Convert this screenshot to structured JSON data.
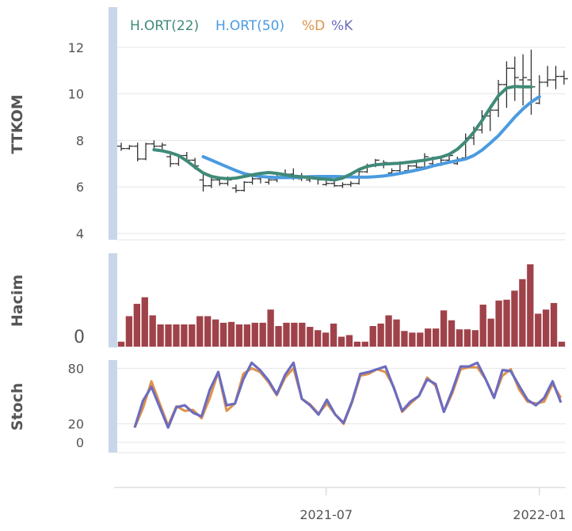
{
  "chart_data": {
    "type": "stock-panels",
    "colors": {
      "ohlc": "#333333",
      "ma22": "#3f8a78",
      "ma50": "#4a9be0",
      "stoch_d": "#e0924a",
      "stoch_k": "#6c6cbf",
      "volume": "#a0424a",
      "panel_bar": "#c9d6ea",
      "grid": "#e5e5e5"
    },
    "legend": [
      {
        "label": "H.ORT(22)",
        "color": "#3f8a78"
      },
      {
        "label": "H.ORT(50)",
        "color": "#4a9be0"
      },
      {
        "label": "%D",
        "color": "#e0924a"
      },
      {
        "label": "%K",
        "color": "#6c6cbf"
      }
    ],
    "x_ticks": [
      {
        "label": "2021-07",
        "week": 25
      },
      {
        "label": "2022-01",
        "week": 51
      }
    ],
    "price_panel": {
      "ylabel": "TTKOM",
      "ylim": [
        3.8,
        13.6
      ],
      "y_ticks": [
        "4",
        "6",
        "8",
        "10",
        "12"
      ],
      "y_tick_values": [
        4,
        6,
        8,
        10,
        12
      ],
      "weeks": 54,
      "ohlc": [
        [
          7.75,
          7.9,
          7.55,
          7.65
        ],
        [
          7.65,
          7.8,
          7.6,
          7.75
        ],
        [
          7.75,
          7.9,
          7.1,
          7.2
        ],
        [
          7.2,
          7.9,
          7.15,
          7.85
        ],
        [
          7.85,
          8.0,
          7.6,
          7.75
        ],
        [
          7.75,
          7.9,
          7.6,
          7.8
        ],
        [
          7.3,
          7.45,
          6.85,
          7.0
        ],
        [
          7.0,
          7.4,
          6.9,
          7.35
        ],
        [
          7.35,
          7.5,
          7.05,
          7.15
        ],
        [
          7.15,
          7.25,
          6.75,
          6.9
        ],
        [
          6.3,
          6.55,
          5.8,
          6.05
        ],
        [
          6.05,
          6.4,
          5.95,
          6.3
        ],
        [
          6.3,
          6.45,
          6.05,
          6.15
        ],
        [
          6.15,
          6.45,
          6.05,
          6.3
        ],
        [
          5.95,
          6.1,
          5.75,
          5.85
        ],
        [
          5.85,
          6.25,
          5.8,
          6.2
        ],
        [
          6.2,
          6.5,
          6.1,
          6.35
        ],
        [
          6.35,
          6.5,
          6.15,
          6.45
        ],
        [
          6.2,
          6.4,
          6.1,
          6.3
        ],
        [
          6.3,
          6.55,
          6.2,
          6.45
        ],
        [
          6.45,
          6.75,
          6.35,
          6.55
        ],
        [
          6.55,
          6.8,
          6.3,
          6.5
        ],
        [
          6.35,
          6.6,
          6.25,
          6.4
        ],
        [
          6.3,
          6.5,
          6.2,
          6.45
        ],
        [
          6.35,
          6.45,
          6.1,
          6.3
        ],
        [
          6.1,
          6.3,
          6.05,
          6.15
        ],
        [
          6.15,
          6.35,
          6.0,
          6.05
        ],
        [
          6.05,
          6.2,
          5.95,
          6.1
        ],
        [
          6.1,
          6.25,
          6.0,
          6.15
        ],
        [
          6.15,
          6.7,
          6.1,
          6.65
        ],
        [
          6.65,
          7.0,
          6.6,
          6.9
        ],
        [
          6.9,
          7.2,
          6.85,
          7.15
        ],
        [
          7.0,
          7.15,
          6.8,
          7.05
        ],
        [
          6.6,
          6.8,
          6.45,
          6.7
        ],
        [
          6.7,
          7.1,
          6.6,
          7.05
        ],
        [
          6.7,
          6.95,
          6.6,
          6.9
        ],
        [
          6.9,
          7.1,
          6.8,
          6.85
        ],
        [
          6.85,
          7.45,
          6.8,
          7.3
        ],
        [
          7.0,
          7.3,
          6.9,
          7.2
        ],
        [
          7.0,
          7.25,
          6.9,
          7.15
        ],
        [
          7.15,
          7.4,
          7.0,
          7.35
        ],
        [
          7.0,
          7.3,
          6.95,
          7.2
        ],
        [
          7.25,
          8.3,
          7.2,
          8.1
        ],
        [
          8.1,
          8.6,
          7.8,
          8.45
        ],
        [
          8.45,
          9.3,
          8.3,
          9.05
        ],
        [
          9.05,
          9.5,
          8.4,
          9.3
        ],
        [
          9.3,
          10.6,
          9.0,
          10.4
        ],
        [
          10.4,
          11.4,
          9.4,
          11.1
        ],
        [
          11.1,
          11.6,
          9.7,
          10.7
        ],
        [
          10.6,
          11.7,
          9.5,
          10.7
        ],
        [
          10.6,
          11.9,
          9.1,
          10.3
        ],
        [
          9.6,
          10.8,
          9.55,
          10.5
        ],
        [
          10.5,
          11.2,
          10.3,
          10.6
        ],
        [
          10.6,
          11.2,
          10.2,
          10.75
        ],
        [
          10.75,
          11.0,
          10.4,
          10.65
        ]
      ],
      "ma22": [
        7.6,
        7.55,
        7.47,
        7.35,
        7.12,
        6.85,
        6.6,
        6.45,
        6.38,
        6.35,
        6.38,
        6.45,
        6.52,
        6.58,
        6.62,
        6.58,
        6.52,
        6.46,
        6.44,
        6.4,
        6.36,
        6.33,
        6.3,
        6.38,
        6.55,
        6.75,
        6.88,
        6.95,
        6.98,
        7.0,
        7.02,
        7.06,
        7.1,
        7.15,
        7.22,
        7.28,
        7.4,
        7.62,
        7.95,
        8.35,
        8.85,
        9.4,
        9.92,
        10.25,
        10.32,
        10.3,
        10.3
      ],
      "ma50": [
        7.3,
        7.15,
        7.0,
        6.85,
        6.7,
        6.57,
        6.5,
        6.45,
        6.42,
        6.4,
        6.4,
        6.4,
        6.42,
        6.44,
        6.45,
        6.45,
        6.45,
        6.44,
        6.43,
        6.42,
        6.42,
        6.44,
        6.47,
        6.52,
        6.58,
        6.65,
        6.72,
        6.8,
        6.9,
        6.98,
        7.06,
        7.13,
        7.2,
        7.35,
        7.58,
        7.88,
        8.2,
        8.6,
        9.0,
        9.35,
        9.65,
        9.88
      ]
    },
    "volume_panel": {
      "ylabel": "Hacim",
      "y_ticks": [
        "0"
      ],
      "values": [
        0.06,
        0.37,
        0.52,
        0.6,
        0.38,
        0.27,
        0.27,
        0.27,
        0.27,
        0.27,
        0.37,
        0.37,
        0.33,
        0.29,
        0.3,
        0.27,
        0.27,
        0.29,
        0.29,
        0.45,
        0.25,
        0.29,
        0.29,
        0.29,
        0.24,
        0.2,
        0.17,
        0.28,
        0.12,
        0.14,
        0.06,
        0.06,
        0.25,
        0.28,
        0.38,
        0.33,
        0.19,
        0.17,
        0.17,
        0.22,
        0.22,
        0.44,
        0.32,
        0.21,
        0.21,
        0.2,
        0.51,
        0.34,
        0.56,
        0.57,
        0.68,
        0.82,
        1.0,
        0.4,
        0.45,
        0.53,
        0.06
      ]
    },
    "stoch_panel": {
      "ylabel": "Stoch",
      "ylim": [
        0,
        100
      ],
      "y_ticks": [
        "0",
        "20",
        "80"
      ],
      "y_tick_values": [
        0,
        20,
        80
      ],
      "k": [
        16,
        45,
        60,
        38,
        16,
        38,
        40,
        32,
        28,
        57,
        76,
        40,
        42,
        68,
        86,
        78,
        67,
        52,
        73,
        86,
        47,
        40,
        30,
        46,
        30,
        21,
        44,
        74,
        76,
        79,
        82,
        59,
        34,
        44,
        50,
        68,
        63,
        33,
        56,
        82,
        82,
        86,
        68,
        48,
        78,
        77,
        61,
        46,
        40,
        48,
        66,
        43
      ],
      "d": [
        16,
        37,
        66,
        42,
        18,
        39,
        34,
        35,
        26,
        48,
        76,
        34,
        42,
        74,
        80,
        76,
        65,
        51,
        70,
        80,
        47,
        41,
        31,
        42,
        30,
        20,
        43,
        72,
        74,
        79,
        76,
        60,
        33,
        42,
        50,
        70,
        61,
        33,
        53,
        79,
        81,
        81,
        68,
        49,
        72,
        79,
        57,
        44,
        42,
        44,
        63,
        48
      ]
    }
  }
}
